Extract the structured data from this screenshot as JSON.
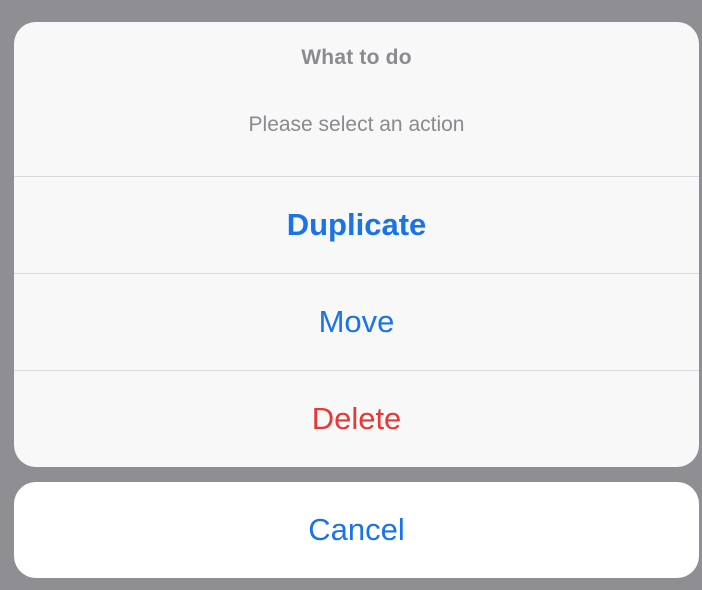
{
  "colors": {
    "backdrop": "#8e8e93",
    "accent": "#1a73e8",
    "destructive": "#e53935",
    "secondary_text": "#8a8a8f",
    "sheet_bg": "#f8f8f8"
  },
  "action_sheet": {
    "title": "What to do",
    "message": "Please select an action",
    "actions": [
      {
        "label": "Duplicate",
        "style": "primary"
      },
      {
        "label": "Move",
        "style": "default"
      },
      {
        "label": "Delete",
        "style": "destructive"
      }
    ]
  },
  "cancel": {
    "label": "Cancel"
  }
}
